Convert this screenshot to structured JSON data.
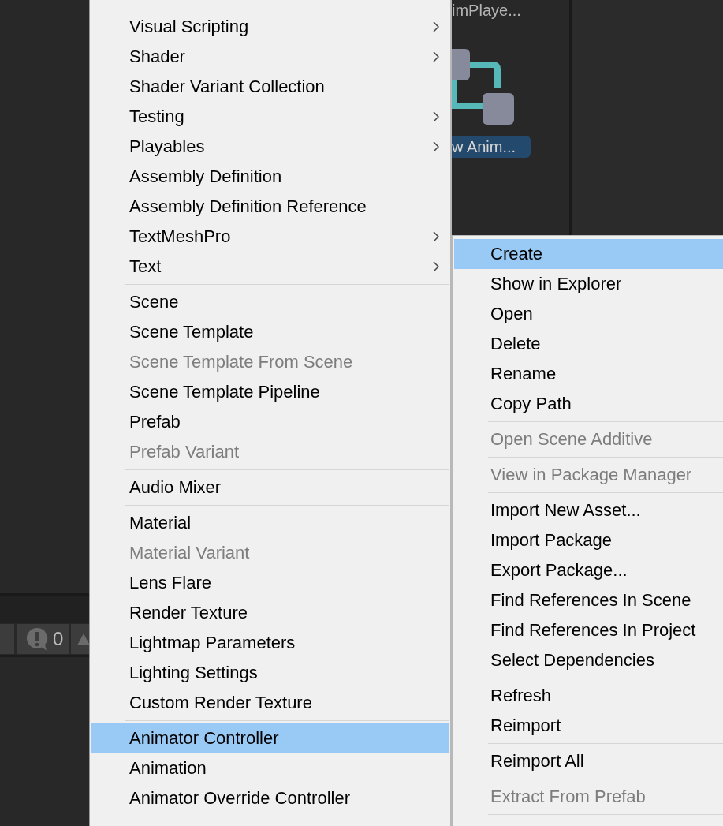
{
  "project_panel": {
    "asset_name_partial": "imPlaye...",
    "selected_asset_label": "w Anim..."
  },
  "console_toolbar": {
    "error_count": "0"
  },
  "left_menu": {
    "items": [
      {
        "kind": "item",
        "label": "Visual Scripting",
        "submenu": true,
        "disabled": false,
        "selected": false
      },
      {
        "kind": "item",
        "label": "Shader",
        "submenu": true,
        "disabled": false,
        "selected": false
      },
      {
        "kind": "item",
        "label": "Shader Variant Collection",
        "submenu": false,
        "disabled": false,
        "selected": false
      },
      {
        "kind": "item",
        "label": "Testing",
        "submenu": true,
        "disabled": false,
        "selected": false
      },
      {
        "kind": "item",
        "label": "Playables",
        "submenu": true,
        "disabled": false,
        "selected": false
      },
      {
        "kind": "item",
        "label": "Assembly Definition",
        "submenu": false,
        "disabled": false,
        "selected": false
      },
      {
        "kind": "item",
        "label": "Assembly Definition Reference",
        "submenu": false,
        "disabled": false,
        "selected": false
      },
      {
        "kind": "item",
        "label": "TextMeshPro",
        "submenu": true,
        "disabled": false,
        "selected": false
      },
      {
        "kind": "item",
        "label": "Text",
        "submenu": true,
        "disabled": false,
        "selected": false
      },
      {
        "kind": "separator"
      },
      {
        "kind": "item",
        "label": "Scene",
        "submenu": false,
        "disabled": false,
        "selected": false
      },
      {
        "kind": "item",
        "label": "Scene Template",
        "submenu": false,
        "disabled": false,
        "selected": false
      },
      {
        "kind": "item",
        "label": "Scene Template From Scene",
        "submenu": false,
        "disabled": true,
        "selected": false
      },
      {
        "kind": "item",
        "label": "Scene Template Pipeline",
        "submenu": false,
        "disabled": false,
        "selected": false
      },
      {
        "kind": "item",
        "label": "Prefab",
        "submenu": false,
        "disabled": false,
        "selected": false
      },
      {
        "kind": "item",
        "label": "Prefab Variant",
        "submenu": false,
        "disabled": true,
        "selected": false
      },
      {
        "kind": "separator"
      },
      {
        "kind": "item",
        "label": "Audio Mixer",
        "submenu": false,
        "disabled": false,
        "selected": false
      },
      {
        "kind": "separator"
      },
      {
        "kind": "item",
        "label": "Material",
        "submenu": false,
        "disabled": false,
        "selected": false
      },
      {
        "kind": "item",
        "label": "Material Variant",
        "submenu": false,
        "disabled": true,
        "selected": false
      },
      {
        "kind": "item",
        "label": "Lens Flare",
        "submenu": false,
        "disabled": false,
        "selected": false
      },
      {
        "kind": "item",
        "label": "Render Texture",
        "submenu": false,
        "disabled": false,
        "selected": false
      },
      {
        "kind": "item",
        "label": "Lightmap Parameters",
        "submenu": false,
        "disabled": false,
        "selected": false
      },
      {
        "kind": "item",
        "label": "Lighting Settings",
        "submenu": false,
        "disabled": false,
        "selected": false
      },
      {
        "kind": "item",
        "label": "Custom Render Texture",
        "submenu": false,
        "disabled": false,
        "selected": false
      },
      {
        "kind": "separator"
      },
      {
        "kind": "item",
        "label": "Animator Controller",
        "submenu": false,
        "disabled": false,
        "selected": true
      },
      {
        "kind": "item",
        "label": "Animation",
        "submenu": false,
        "disabled": false,
        "selected": false
      },
      {
        "kind": "item",
        "label": "Animator Override Controller",
        "submenu": false,
        "disabled": false,
        "selected": false
      }
    ]
  },
  "right_menu": {
    "items": [
      {
        "kind": "item",
        "label": "Create",
        "disabled": false,
        "selected": true
      },
      {
        "kind": "item",
        "label": "Show in Explorer",
        "disabled": false,
        "selected": false
      },
      {
        "kind": "item",
        "label": "Open",
        "disabled": false,
        "selected": false
      },
      {
        "kind": "item",
        "label": "Delete",
        "disabled": false,
        "selected": false
      },
      {
        "kind": "item",
        "label": "Rename",
        "disabled": false,
        "selected": false
      },
      {
        "kind": "item",
        "label": "Copy Path",
        "disabled": false,
        "selected": false
      },
      {
        "kind": "separator"
      },
      {
        "kind": "item",
        "label": "Open Scene Additive",
        "disabled": true,
        "selected": false
      },
      {
        "kind": "separator"
      },
      {
        "kind": "item",
        "label": "View in Package Manager",
        "disabled": true,
        "selected": false
      },
      {
        "kind": "separator"
      },
      {
        "kind": "item",
        "label": "Import New Asset...",
        "disabled": false,
        "selected": false
      },
      {
        "kind": "item",
        "label": "Import Package",
        "disabled": false,
        "selected": false
      },
      {
        "kind": "item",
        "label": "Export Package...",
        "disabled": false,
        "selected": false
      },
      {
        "kind": "item",
        "label": "Find References In Scene",
        "disabled": false,
        "selected": false
      },
      {
        "kind": "item",
        "label": "Find References In Project",
        "disabled": false,
        "selected": false
      },
      {
        "kind": "item",
        "label": "Select Dependencies",
        "disabled": false,
        "selected": false
      },
      {
        "kind": "separator"
      },
      {
        "kind": "item",
        "label": "Refresh",
        "disabled": false,
        "selected": false
      },
      {
        "kind": "item",
        "label": "Reimport",
        "disabled": false,
        "selected": false
      },
      {
        "kind": "separator"
      },
      {
        "kind": "item",
        "label": "Reimport All",
        "disabled": false,
        "selected": false
      },
      {
        "kind": "separator"
      },
      {
        "kind": "item",
        "label": "Extract From Prefab",
        "disabled": true,
        "selected": false
      },
      {
        "kind": "separator"
      }
    ]
  }
}
